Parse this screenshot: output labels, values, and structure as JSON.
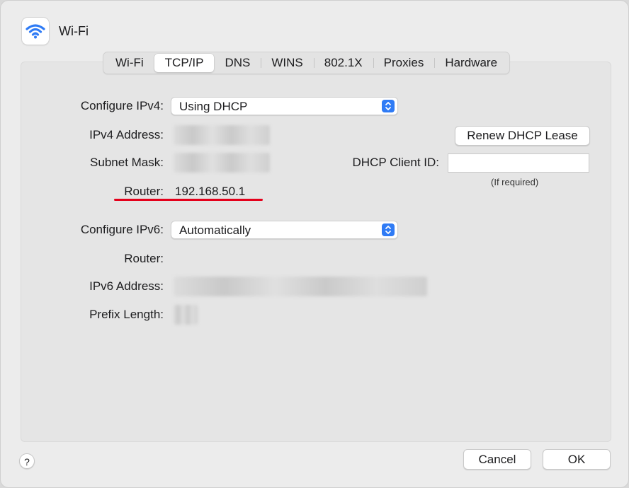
{
  "window": {
    "title": "Wi-Fi",
    "icon": "wifi-icon",
    "accent_color": "#2f7bf5"
  },
  "tabs": [
    {
      "label": "Wi-Fi",
      "active": false
    },
    {
      "label": "TCP/IP",
      "active": true
    },
    {
      "label": "DNS",
      "active": false
    },
    {
      "label": "WINS",
      "active": false
    },
    {
      "label": "802.1X",
      "active": false
    },
    {
      "label": "Proxies",
      "active": false
    },
    {
      "label": "Hardware",
      "active": false
    }
  ],
  "ipv4": {
    "configure_label": "Configure IPv4:",
    "configure_value": "Using DHCP",
    "address_label": "IPv4 Address:",
    "subnet_label": "Subnet Mask:",
    "router_label": "Router:",
    "router_value": "192.168.50.1",
    "renew_button": "Renew DHCP Lease",
    "client_id_label": "DHCP Client ID:",
    "client_id_value": "",
    "client_id_note": "(If required)"
  },
  "ipv6": {
    "configure_label": "Configure IPv6:",
    "configure_value": "Automatically",
    "router_label": "Router:",
    "address_label": "IPv6 Address:",
    "prefix_label": "Prefix Length:"
  },
  "annotation": {
    "underline_color": "#e4001b"
  },
  "footer": {
    "help_label": "?",
    "cancel_label": "Cancel",
    "ok_label": "OK"
  }
}
